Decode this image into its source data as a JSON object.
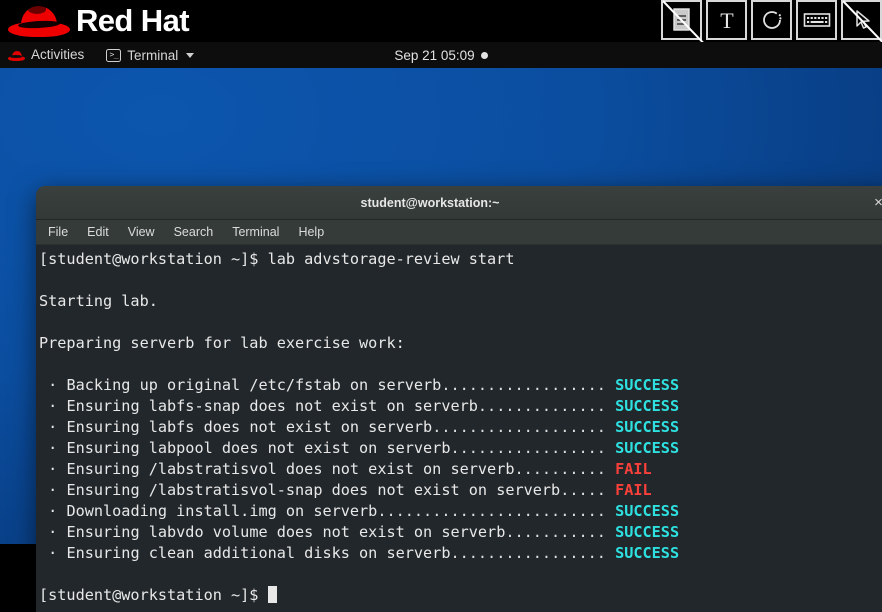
{
  "brand": {
    "name": "Red Hat",
    "logo_icon": "red-hat-fedora-logo"
  },
  "exam_toolbar": {
    "buttons": [
      {
        "icon": "notes-document-icon",
        "label": "Notes",
        "disabled": true
      },
      {
        "icon": "text-tool-icon",
        "label": "T",
        "disabled": false
      },
      {
        "icon": "refresh-circle-icon",
        "label": "Refresh",
        "disabled": false
      },
      {
        "icon": "keyboard-icon",
        "label": "Keyboard",
        "disabled": false
      },
      {
        "icon": "mouse-pointer-icon",
        "label": "Pointer",
        "disabled": true
      }
    ]
  },
  "top_panel": {
    "activities_label": "Activities",
    "activities_icon": "red-hat-fedora-icon",
    "app_menu_label": "Terminal",
    "app_menu_icon": "terminal-icon",
    "app_menu_caret": "chevron-down-icon",
    "clock": "Sep 21  05:09",
    "notification_dot": "●"
  },
  "terminal_window": {
    "title": "student@workstation:~",
    "close_label": "×",
    "menus": [
      "File",
      "Edit",
      "View",
      "Search",
      "Terminal",
      "Help"
    ]
  },
  "terminal_content": {
    "prompt": "[student@workstation ~]$",
    "command": "lab advstorage-review start",
    "blank1": "",
    "starting_line": "Starting lab.",
    "blank2": "",
    "preparing_line": "Preparing serverb for lab exercise work:",
    "blank3": "",
    "tasks": [
      {
        "bullet": "·",
        "text": " Backing up original /etc/fstab on serverb",
        "dots": "..................",
        "status": "SUCCESS",
        "state": "ok"
      },
      {
        "bullet": "·",
        "text": " Ensuring labfs-snap does not exist on serverb",
        "dots": "..............",
        "status": "SUCCESS",
        "state": "ok"
      },
      {
        "bullet": "·",
        "text": " Ensuring labfs does not exist on serverb",
        "dots": "...................",
        "status": "SUCCESS",
        "state": "ok"
      },
      {
        "bullet": "·",
        "text": " Ensuring labpool does not exist on serverb",
        "dots": ".................",
        "status": "SUCCESS",
        "state": "ok"
      },
      {
        "bullet": "·",
        "text": " Ensuring /labstratisvol does not exist on serverb",
        "dots": "..........",
        "status": "FAIL",
        "state": "fail"
      },
      {
        "bullet": "·",
        "text": " Ensuring /labstratisvol-snap does not exist on serverb",
        "dots": ".....",
        "status": "FAIL",
        "state": "fail"
      },
      {
        "bullet": "·",
        "text": " Downloading install.img on serverb",
        "dots": ".........................",
        "status": "SUCCESS",
        "state": "ok"
      },
      {
        "bullet": "·",
        "text": " Ensuring labvdo volume does not exist on serverb",
        "dots": "...........",
        "status": "SUCCESS",
        "state": "ok"
      },
      {
        "bullet": "·",
        "text": " Ensuring clean additional disks on serverb",
        "dots": ".................",
        "status": "SUCCESS",
        "state": "ok"
      }
    ],
    "blank4": "",
    "final_prompt": "[student@workstation ~]$",
    "cursor": "block-cursor"
  },
  "colors": {
    "brand_red": "#ee0000",
    "terminal_bg": "#22272b",
    "titlebar_bg": "#353b39",
    "desktop_blue": "#0b4ea0",
    "success_cyan": "#2ee0e0",
    "fail_red": "#f9403a"
  }
}
